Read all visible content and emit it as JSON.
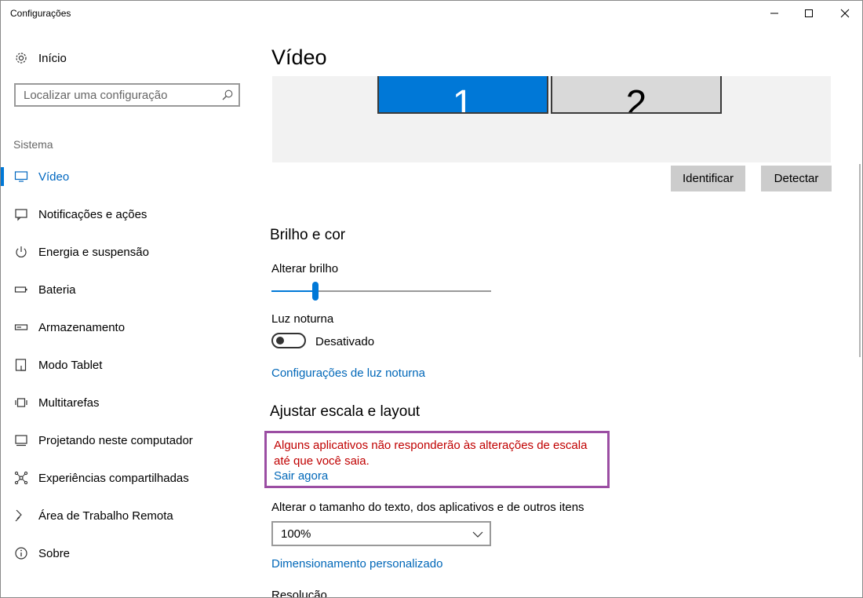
{
  "window": {
    "title": "Configurações"
  },
  "sidebar": {
    "home_label": "Início",
    "search_placeholder": "Localizar uma configuração",
    "section_label": "Sistema",
    "items": [
      {
        "label": "Vídeo",
        "icon": "monitor-icon",
        "active": true
      },
      {
        "label": "Notificações e ações",
        "icon": "message-icon",
        "active": false
      },
      {
        "label": "Energia e suspensão",
        "icon": "power-icon",
        "active": false
      },
      {
        "label": "Bateria",
        "icon": "battery-icon",
        "active": false
      },
      {
        "label": "Armazenamento",
        "icon": "storage-icon",
        "active": false
      },
      {
        "label": "Modo Tablet",
        "icon": "tablet-icon",
        "active": false
      },
      {
        "label": "Multitarefas",
        "icon": "multitask-icon",
        "active": false
      },
      {
        "label": "Projetando neste computador",
        "icon": "project-icon",
        "active": false
      },
      {
        "label": "Experiências compartilhadas",
        "icon": "share-icon",
        "active": false
      },
      {
        "label": "Área de Trabalho Remota",
        "icon": "remote-desktop-icon",
        "active": false
      },
      {
        "label": "Sobre",
        "icon": "info-icon",
        "active": false
      }
    ]
  },
  "main": {
    "title": "Vídeo",
    "monitors": [
      "1",
      "2"
    ],
    "identify_label": "Identificar",
    "detect_label": "Detectar",
    "brightness_heading": "Brilho e cor",
    "brightness_label": "Alterar brilho",
    "brightness_value": 0.2,
    "night_light_label": "Luz noturna",
    "night_light_state": "Desativado",
    "night_light_link": "Configurações de luz noturna",
    "scale_heading": "Ajustar escala e layout",
    "scale_warning": "Alguns aplicativos não responderão às alterações de escala até que você saia.",
    "sign_out_link": "Sair agora",
    "scale_label": "Alterar o tamanho do texto, dos aplicativos e de outros itens",
    "scale_value": "100%",
    "custom_scaling_link": "Dimensionamento personalizado",
    "resolution_label": "Resolução"
  },
  "colors": {
    "accent": "#0078d7",
    "link": "#0067b8",
    "warning_text": "#c00000",
    "highlight_border": "#9b4ea3"
  }
}
